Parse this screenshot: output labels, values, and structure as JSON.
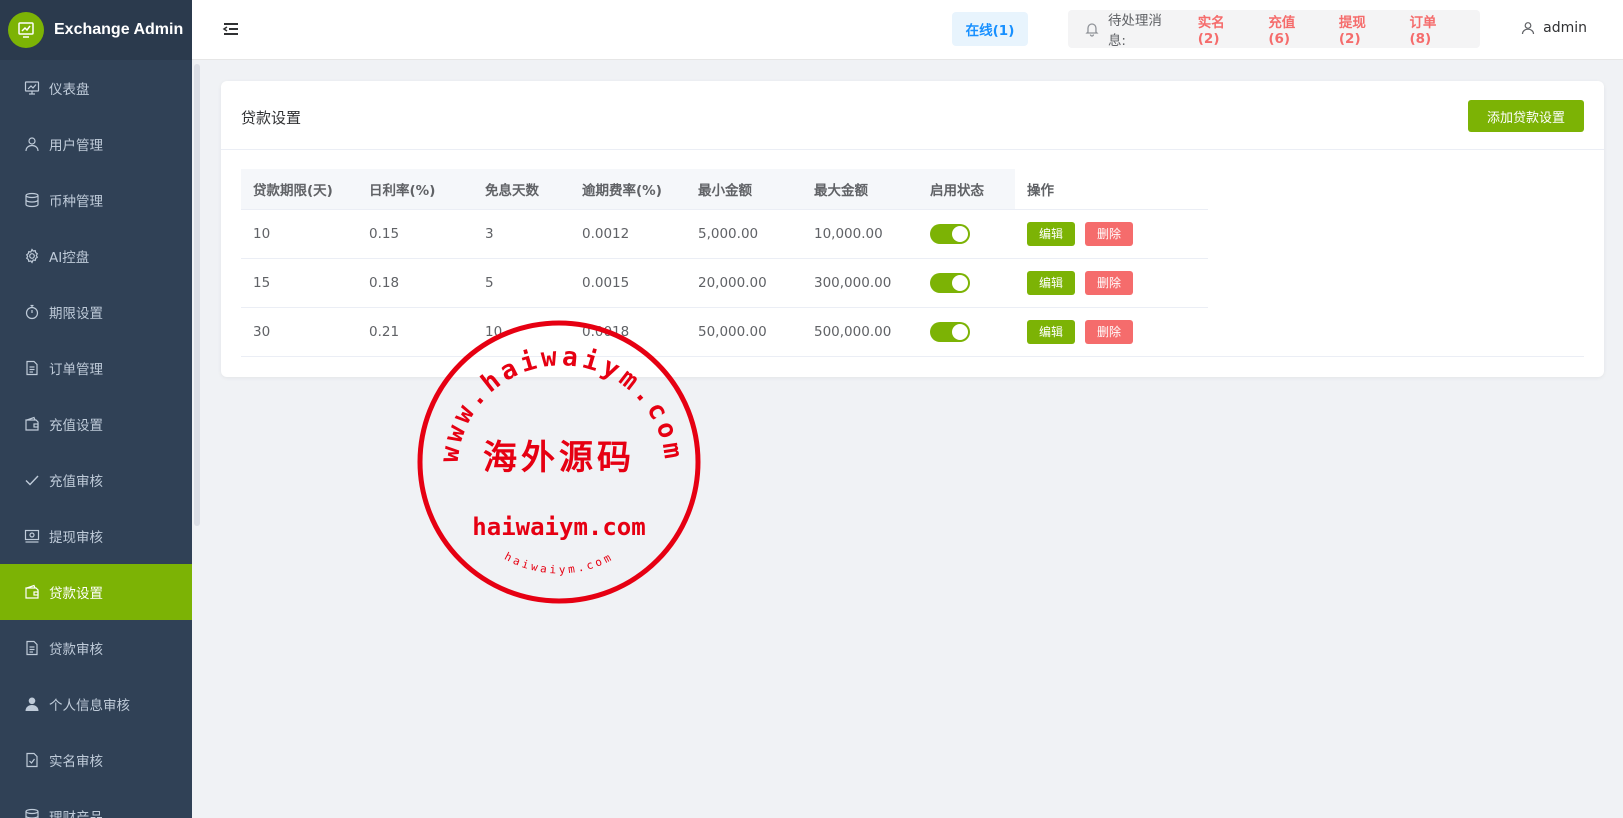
{
  "brand": {
    "title": "Exchange Admin"
  },
  "sidebar": {
    "items": [
      {
        "label": "仪表盘",
        "icon": "dashboard-icon"
      },
      {
        "label": "用户管理",
        "icon": "user-icon"
      },
      {
        "label": "币种管理",
        "icon": "database-icon"
      },
      {
        "label": "AI控盘",
        "icon": "gear-icon"
      },
      {
        "label": "期限设置",
        "icon": "stopwatch-icon"
      },
      {
        "label": "订单管理",
        "icon": "document-icon"
      },
      {
        "label": "充值设置",
        "icon": "wallet-icon"
      },
      {
        "label": "充值审核",
        "icon": "check-icon"
      },
      {
        "label": "提现审核",
        "icon": "money-icon"
      },
      {
        "label": "贷款设置",
        "icon": "wallet-icon",
        "active": true
      },
      {
        "label": "贷款审核",
        "icon": "document-icon"
      },
      {
        "label": "个人信息审核",
        "icon": "user-solid-icon"
      },
      {
        "label": "实名审核",
        "icon": "document-check-icon"
      },
      {
        "label": "理财产品",
        "icon": "database-icon"
      }
    ]
  },
  "header": {
    "online": "在线(1)",
    "notice_label": "待处理消息:",
    "notices": [
      "实名(2)",
      "充值(6)",
      "提现(2)",
      "订单(8)"
    ],
    "username": "admin"
  },
  "card": {
    "title": "贷款设置",
    "add_button": "添加贷款设置"
  },
  "table": {
    "columns": [
      "贷款期限(天)",
      "日利率(%)",
      "免息天数",
      "逾期费率(%)",
      "最小金额",
      "最大金额",
      "启用状态",
      "操作"
    ],
    "rows": [
      [
        "10",
        "0.15",
        "3",
        "0.0012",
        "5,000.00",
        "10,000.00"
      ],
      [
        "15",
        "0.18",
        "5",
        "0.0015",
        "20,000.00",
        "300,000.00"
      ],
      [
        "30",
        "0.21",
        "10",
        "0.0018",
        "50,000.00",
        "500,000.00"
      ]
    ],
    "enabled": [
      true,
      true,
      true
    ],
    "edit_label": "编辑",
    "delete_label": "删除"
  },
  "watermark": {
    "outer_text": "www.haiwaiym.com",
    "center_text": "海外源码",
    "domain_text": "haiwaiym.com",
    "bottom_text": "haiwaiym.com",
    "color": "#e60012"
  },
  "colors": {
    "accent": "#7cb305",
    "danger": "#f56c6c",
    "sidebar": "#304156",
    "online": "#1890ff"
  }
}
